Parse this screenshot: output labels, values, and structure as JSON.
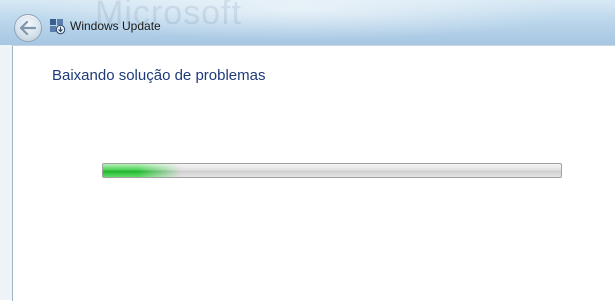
{
  "window": {
    "title": "Windows Update",
    "watermark_text": "Microsoft"
  },
  "content": {
    "heading": "Baixando solução de problemas"
  },
  "progress": {
    "value_percent": 17,
    "color": "#22b52e"
  },
  "icons": {
    "back": "back-arrow-icon",
    "app": "windows-update-icon"
  }
}
